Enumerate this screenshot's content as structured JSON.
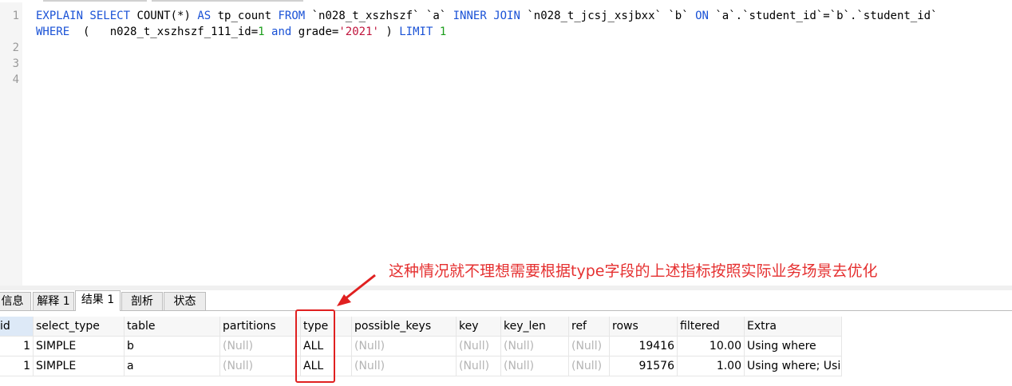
{
  "editor": {
    "line_numbers": [
      "1",
      "2",
      "3",
      "4"
    ],
    "line1": {
      "kw1": "EXPLAIN SELECT",
      "t1": " COUNT(*) ",
      "kw2": "AS",
      "t2": " tp_count ",
      "kw3": "FROM",
      "t3": " `n028_t_xszhszf` `a` ",
      "kw4": "INNER JOIN",
      "t4": " `n028_t_jcsj_xsjbxx` `b` ",
      "kw5": "ON",
      "t5": " `a`.`student_id`=`b`.`student_id`"
    },
    "line1b": {
      "kw1": "WHERE",
      "t1": "  (   n028_t_xszhszf_111_id=",
      "n1": "1",
      "t2": " ",
      "kw2": "and",
      "t3": " grade=",
      "s1": "'2021'",
      "t4": " ) ",
      "kw3": "LIMIT",
      "t5": " ",
      "n2": "1"
    }
  },
  "annotation": "这种情况就不理想需要根据type字段的上述指标按照实际业务场景去优化",
  "tabs": [
    {
      "label": "信息"
    },
    {
      "label": "解释 1"
    },
    {
      "label": "结果 1"
    },
    {
      "label": "剖析"
    },
    {
      "label": "状态"
    }
  ],
  "grid": {
    "columns": [
      "id",
      "select_type",
      "table",
      "partitions",
      "type",
      "possible_keys",
      "key",
      "key_len",
      "ref",
      "rows",
      "filtered",
      "Extra"
    ],
    "rows": [
      {
        "id": "1",
        "select_type": "SIMPLE",
        "table": "b",
        "partitions": "(Null)",
        "type": "ALL",
        "possible_keys": "(Null)",
        "key": "(Null)",
        "key_len": "(Null)",
        "ref": "(Null)",
        "rows": "19416",
        "filtered": "10.00",
        "Extra": "Using where"
      },
      {
        "id": "1",
        "select_type": "SIMPLE",
        "table": "a",
        "partitions": "(Null)",
        "type": "ALL",
        "possible_keys": "(Null)",
        "key": "(Null)",
        "key_len": "(Null)",
        "ref": "(Null)",
        "rows": "91576",
        "filtered": "1.00",
        "Extra": "Using where; Usi"
      }
    ]
  },
  "colors": {
    "keyword": "#1a52d6",
    "string": "#c0143c",
    "number": "#1c9e1c",
    "annotation": "#e53030",
    "null_text": "#b4b4b4"
  }
}
